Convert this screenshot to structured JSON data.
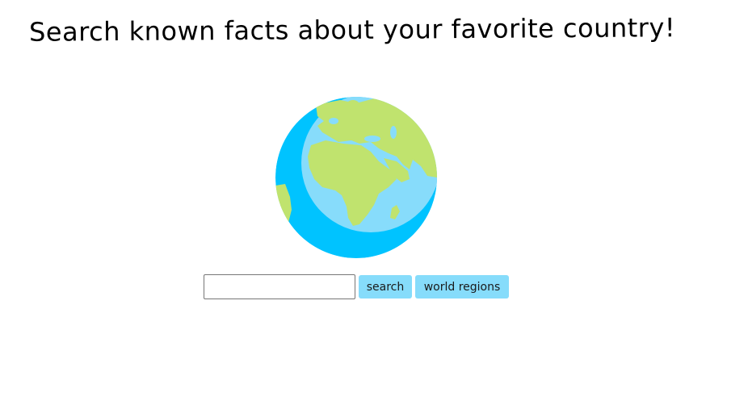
{
  "header": {
    "title": "Search known facts about your favorite country!"
  },
  "hero": {
    "icon": "globe-icon"
  },
  "search": {
    "value": "",
    "placeholder": "",
    "search_label": "search",
    "regions_label": "world regions"
  },
  "colors": {
    "button_bg": "#86dcfb",
    "ocean_dark": "#00c3ff",
    "ocean_light": "#87dcfb",
    "land": "#c0e36e"
  }
}
